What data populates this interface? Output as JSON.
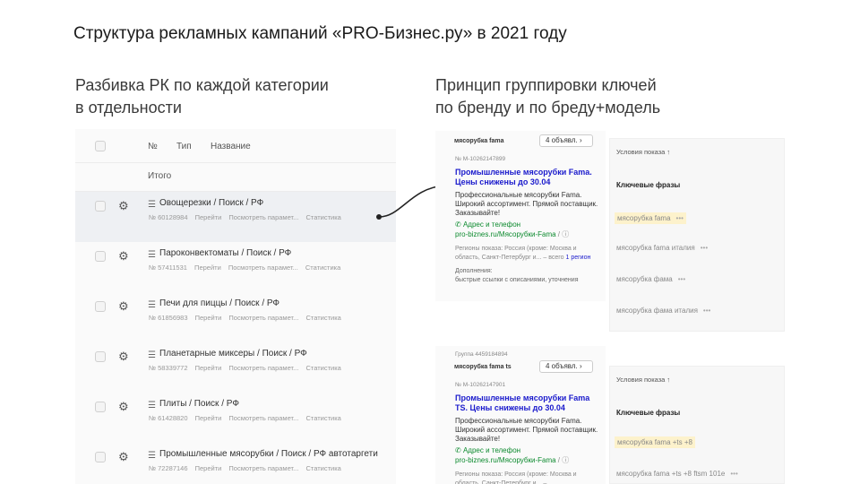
{
  "slide_title": "Структура рекламных кампаний «PRO-Бизнес.ру» в 2021 году",
  "left_section": {
    "title_line1": "Разбивка РК по каждой категории",
    "title_line2": "в отдельности"
  },
  "right_section": {
    "title_line1": "Принцип группировки ключей",
    "title_line2": "по бренду и по бреду+модель"
  },
  "table": {
    "columns": {
      "number": "№",
      "type": "Тип",
      "name": "Название"
    },
    "total_label": "Итого",
    "link_go": "Перейти",
    "link_params": "Посмотреть парамет...",
    "link_stats": "Статистика",
    "rows": [
      {
        "name": "Овощерезки / Поиск / РФ",
        "number": "№ 60128984"
      },
      {
        "name": "Пароконвектоматы / Поиск / РФ",
        "number": "№ 57411531"
      },
      {
        "name": "Печи для пиццы / Поиск / РФ",
        "number": "№ 61856983"
      },
      {
        "name": "Планетарные миксеры / Поиск / РФ",
        "number": "№ 58339772"
      },
      {
        "name": "Плиты / Поиск / РФ",
        "number": "№ 61428820"
      },
      {
        "name": "Промышленные мясорубки / Поиск / РФ автотаргети",
        "number": "№ 72287146"
      }
    ]
  },
  "ads": [
    {
      "group_label": "",
      "group_name": "мясорубка fama",
      "count_button": "4 объявл.",
      "number": "№ M-10262147899",
      "title": "Промышленные мясорубки Fama. Цены снижены до 30.04",
      "text": "Профессиональные мясорубки Fama. Широкий ассортимент. Прямой поставщик. Заказывайте!",
      "contacts": "Адрес и телефон",
      "url": "pro-biznes.ru/Мясорубки-Fama",
      "regions": "Регионы показа: Россия (кроме: Москва и область, Санкт-Петербург и... –",
      "regions_total": "всего",
      "regions_link": "1 регион",
      "extras_label": "Дополнения:",
      "extras_text": "быстрые ссылки с описаниями, уточнения"
    },
    {
      "group_label": "Группа 4459184894",
      "group_name": "мясорубка fama ts",
      "count_button": "4 объявл.",
      "number": "№ M-10262147901",
      "title": "Промышленные мясорубки Fama TS. Цены снижены до 30.04",
      "text": "Профессиональные мясорубки Fama. Широкий ассортимент. Прямой поставщик. Заказывайте!",
      "contacts": "Адрес и телефон",
      "url": "pro-biznes.ru/Мясорубки-Fama",
      "regions": "Регионы показа: Россия (кроме: Москва и область, Санкт-Петербург и... –"
    }
  ],
  "conditions": [
    {
      "header": "Условия показа ↑",
      "sub": "Ключевые фразы",
      "phrases": [
        "мясорубка fama",
        "мясорубка fama италия",
        "мясорубка фама",
        "мясорубка фама италия"
      ]
    },
    {
      "header": "Условия показа ↑",
      "sub": "Ключевые фразы",
      "phrases": [
        "мясорубка fama +ts +8",
        "мясорубка fama +ts +8 ftsm 101e"
      ]
    }
  ],
  "icons": {
    "gear": "gear-icon",
    "list": "list-icon",
    "arrow": "arrow-connector",
    "phone": "phone-icon",
    "help": "help-icon"
  }
}
